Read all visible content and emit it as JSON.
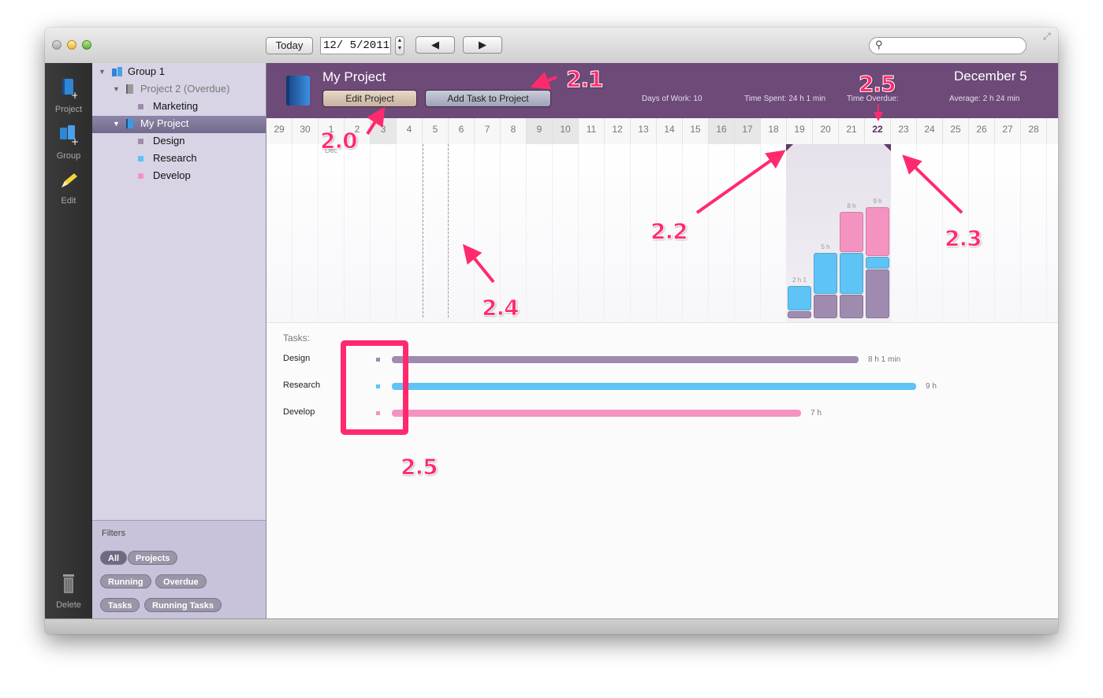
{
  "titlebar": {
    "today_label": "Today",
    "date_value": "12/  5/2011",
    "prev_label": "◀",
    "next_label": "▶",
    "search_placeholder": ""
  },
  "toolbar": {
    "project_label": "Project",
    "group_label": "Group",
    "edit_label": "Edit",
    "delete_label": "Delete"
  },
  "sidebar": {
    "group1": "Group 1",
    "project2": "Project 2 (Overdue)",
    "marketing": "Marketing",
    "my_project": "My Project",
    "design": "Design",
    "research": "Research",
    "develop": "Develop"
  },
  "filters": {
    "heading": "Filters",
    "all": "All",
    "projects": "Projects",
    "running": "Running",
    "overdue": "Overdue",
    "tasks": "Tasks",
    "running_tasks": "Running Tasks"
  },
  "header": {
    "title": "My Project",
    "edit_project": "Edit Project",
    "add_task": "Add Task to Project",
    "days_of_work": "Days of Work: 10",
    "time_spent": "Time Spent: 24 h 1 min",
    "time_overdue": "Time Overdue:",
    "average": "Average: 2 h 24 min",
    "date_heading": "December 5"
  },
  "days": [
    "29",
    "30",
    "1",
    "2",
    "3",
    "4",
    "5",
    "6",
    "7",
    "8",
    "9",
    "10",
    "11",
    "12",
    "13",
    "14",
    "15",
    "16",
    "17",
    "18",
    "19",
    "20",
    "21",
    "22",
    "23",
    "24",
    "25",
    "26",
    "27",
    "28"
  ],
  "month_marker": "Dec",
  "chart_data": {
    "type": "bar",
    "categories": [
      "19",
      "20",
      "21",
      "22"
    ],
    "series": [
      {
        "name": "Design",
        "values": [
          0.5,
          1.5,
          1.5,
          3
        ]
      },
      {
        "name": "Research",
        "values": [
          1.5,
          2.5,
          2.5,
          0.75
        ]
      },
      {
        "name": "Develop",
        "values": [
          0,
          0,
          2.5,
          3
        ]
      }
    ],
    "labels": [
      "2 h 1",
      "5 h",
      "8 h",
      "9 h"
    ],
    "colors": {
      "Design": "#a08bb0",
      "Research": "#5ec3f5",
      "Develop": "#f593c0"
    }
  },
  "tasks": {
    "heading": "Tasks:",
    "rows": [
      {
        "name": "Design",
        "value": "8 h 1 min",
        "color": "#a08bb0",
        "fraction": 0.89
      },
      {
        "name": "Research",
        "value": "9 h",
        "color": "#5ec3f5",
        "fraction": 1.0
      },
      {
        "name": "Develop",
        "value": "7 h",
        "color": "#f593c0",
        "fraction": 0.78
      }
    ]
  },
  "annotations": {
    "a20": "2.0",
    "a21": "2.1",
    "a22": "2.2",
    "a23": "2.3",
    "a24": "2.4",
    "a25_top": "2.5",
    "a25_bottom": "2.5"
  }
}
